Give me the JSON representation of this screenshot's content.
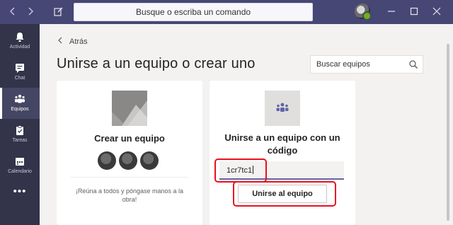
{
  "titlebar": {
    "command_placeholder": "Busque o escriba un comando",
    "back_arrow_icon": "chevron-left-icon",
    "forward_arrow_icon": "chevron-right-icon",
    "compose_icon": "compose-icon",
    "minimize_icon": "minimize-icon",
    "maximize_icon": "maximize-icon",
    "close_icon": "close-icon"
  },
  "rail": {
    "items": [
      {
        "label": "Actividad",
        "icon": "bell-icon"
      },
      {
        "label": "Chat",
        "icon": "chat-icon"
      },
      {
        "label": "Equipos",
        "icon": "teams-icon"
      },
      {
        "label": "Tareas",
        "icon": "tasks-icon"
      },
      {
        "label": "Calendario",
        "icon": "calendar-icon"
      }
    ],
    "more": "•••"
  },
  "main": {
    "back_label": "Atrás",
    "title": "Unirse a un equipo o crear uno",
    "search_placeholder": "Buscar equipos",
    "create_card": {
      "title": "Crear un equipo",
      "description": "¡Reúna a todos y póngase manos a la obra!"
    },
    "join_card": {
      "title_line1": "Unirse a un equipo con un",
      "title_line2": "código",
      "code_value": "1cr7tc1",
      "button_label": "Unirse al equipo"
    }
  },
  "colors": {
    "titlebar": "#464775",
    "rail": "#33344a",
    "accent": "#6264a7",
    "highlight": "#e8101f"
  }
}
